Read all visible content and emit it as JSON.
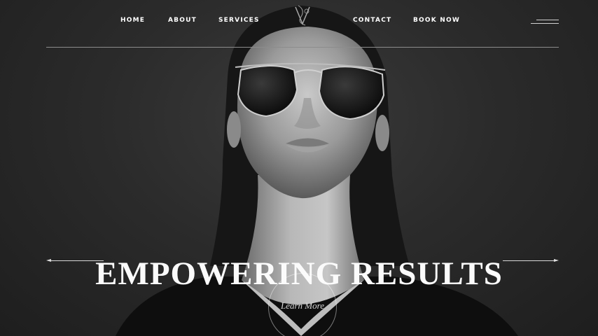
{
  "nav": {
    "home": "HOME",
    "about": "ABOUT",
    "services": "SERVICES",
    "contact": "CONTACT",
    "book_now": "BOOK NOW"
  },
  "logo": {
    "icon": "monogram-logo-icon",
    "name": "",
    "tagline": ""
  },
  "menu": {
    "icon": "hamburger-menu-icon"
  },
  "hero": {
    "headline": "EMPOWERING RESULTS",
    "cta_label": "Learn More",
    "image": "black-and-white portrait photo"
  },
  "colors": {
    "background": "#2a2a2a",
    "text": "#ffffff",
    "divider": "#8c8c8c"
  }
}
